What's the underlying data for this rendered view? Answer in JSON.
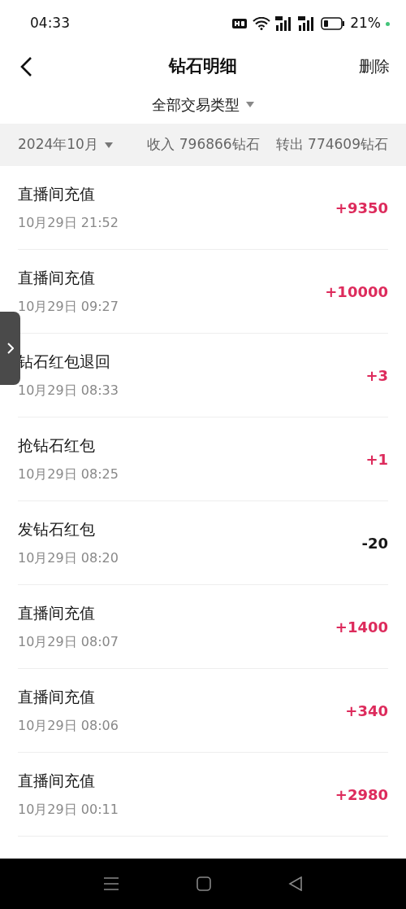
{
  "status_bar": {
    "time": "04:33",
    "battery": "21%"
  },
  "header": {
    "title": "钻石明细",
    "action": "删除"
  },
  "filter": {
    "label": "全部交易类型"
  },
  "summary": {
    "month": "2024年10月",
    "income": "收入 796866钻石",
    "outgo": "转出 774609钻石"
  },
  "rows": [
    {
      "title": "直播间充值",
      "time": "10月29日 21:52",
      "amount": "+9350",
      "kind": "income"
    },
    {
      "title": "直播间充值",
      "time": "10月29日 09:27",
      "amount": "+10000",
      "kind": "income"
    },
    {
      "title": "钻石红包退回",
      "time": "10月29日 08:33",
      "amount": "+3",
      "kind": "income"
    },
    {
      "title": "抢钻石红包",
      "time": "10月29日 08:25",
      "amount": "+1",
      "kind": "income"
    },
    {
      "title": "发钻石红包",
      "time": "10月29日 08:20",
      "amount": "-20",
      "kind": "expense"
    },
    {
      "title": "直播间充值",
      "time": "10月29日 08:07",
      "amount": "+1400",
      "kind": "income"
    },
    {
      "title": "直播间充值",
      "time": "10月29日 08:06",
      "amount": "+340",
      "kind": "income"
    },
    {
      "title": "直播间充值",
      "time": "10月29日 00:11",
      "amount": "+2980",
      "kind": "income"
    }
  ]
}
